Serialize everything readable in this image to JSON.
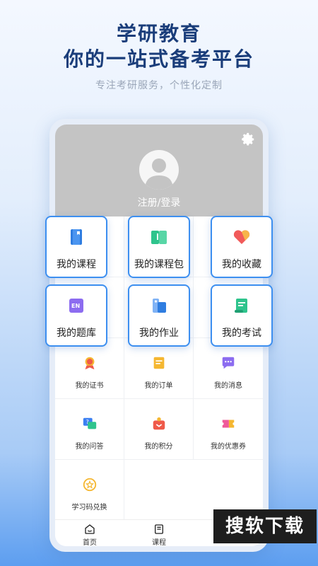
{
  "promo": {
    "title_line1": "学研教育",
    "title_line2": "你的一站式备考平台",
    "subtitle": "专注考研服务，个性化定制"
  },
  "profile": {
    "login_label": "注册/登录",
    "settings_icon": "gear-icon",
    "bg_color": "#c4c4c4"
  },
  "featured": [
    {
      "label": "我的课程",
      "icon": "book-icon"
    },
    {
      "label": "我的课程包",
      "icon": "open-book-icon"
    },
    {
      "label": "我的收藏",
      "icon": "heart-icon"
    },
    {
      "label": "我的题库",
      "icon": "en-book-icon"
    },
    {
      "label": "我的作业",
      "icon": "homework-icon"
    },
    {
      "label": "我的考试",
      "icon": "scroll-icon"
    }
  ],
  "grid": [
    {
      "label": "我的证书",
      "icon": "medal-icon"
    },
    {
      "label": "我的订单",
      "icon": "order-icon"
    },
    {
      "label": "我的消息",
      "icon": "message-icon"
    },
    {
      "label": "我的问答",
      "icon": "qa-icon"
    },
    {
      "label": "我的积分",
      "icon": "points-icon"
    },
    {
      "label": "我的优惠券",
      "icon": "coupon-icon"
    },
    {
      "label": "学习码兑换",
      "icon": "redeem-icon"
    }
  ],
  "tabbar": {
    "home": "首页",
    "course": "课程"
  },
  "watermark": "搜软下载",
  "colors": {
    "accent": "#3d8ff0",
    "title": "#1a3d7a"
  }
}
